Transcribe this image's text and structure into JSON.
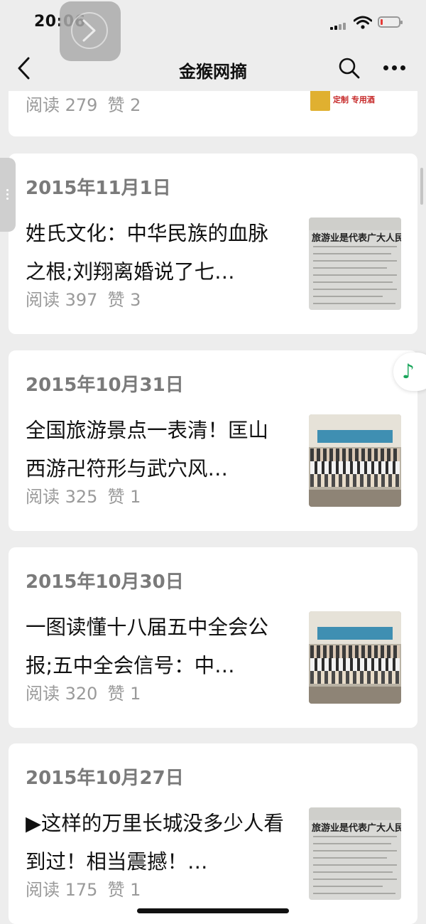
{
  "status_bar": {
    "time": "20:06"
  },
  "nav": {
    "title": "金猴网摘"
  },
  "articles": [
    {
      "date": "",
      "title": "",
      "reads": "阅读 279",
      "likes": "赞 2",
      "thumb_text": "定制  专用酒"
    },
    {
      "date": "2015年11月1日",
      "title": "姓氏文化：中华民族的血脉之根;刘翔离婚说了七…",
      "reads": "阅读 397",
      "likes": "赞 3",
      "thumb_text": "旅游业是代表广大人民根本利益的"
    },
    {
      "date": "2015年10月31日",
      "title": "全国旅游景点一表清！匡山西游卍符形与武穴风…",
      "reads": "阅读 325",
      "likes": "赞 1"
    },
    {
      "date": "2015年10月30日",
      "title": "一图读懂十八届五中全会公报;五中全会信号：中…",
      "reads": "阅读 320",
      "likes": "赞 1"
    },
    {
      "date": "2015年10月27日",
      "title": "▶这样的万里长城没多少人看到过！相当震撼！…",
      "reads": "阅读 175",
      "likes": "赞 1",
      "thumb_text": "旅游业是代表广大人民根本利益的"
    }
  ]
}
